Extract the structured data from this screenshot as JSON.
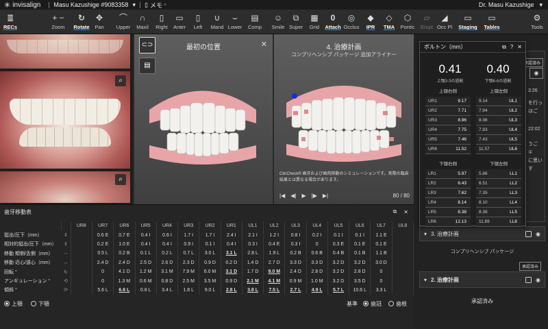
{
  "titlebar": {
    "brand": "invisalign",
    "patient": "Masu Kazushige #9083358",
    "memo": "メモ",
    "doctor": "Dr. Masu Kazushige"
  },
  "toolbar": [
    {
      "id": "recs",
      "label": "RECs",
      "icon": "≣",
      "active": true
    },
    {
      "id": "zoom",
      "label": "Zoom",
      "icon": "+ −"
    },
    {
      "id": "rotate",
      "label": "Rotate",
      "icon": "↻",
      "active": true
    },
    {
      "id": "pan",
      "label": "Pan",
      "icon": "✥"
    },
    {
      "id": "upper",
      "label": "Upper",
      "icon": "⌒"
    },
    {
      "id": "maxil",
      "label": "Maxil",
      "icon": "∩"
    },
    {
      "id": "right",
      "label": "Right",
      "icon": "▯"
    },
    {
      "id": "anter",
      "label": "Anter",
      "icon": "▭"
    },
    {
      "id": "left",
      "label": "Left",
      "icon": "▯"
    },
    {
      "id": "mand",
      "label": "Mand",
      "icon": "∪"
    },
    {
      "id": "lower",
      "label": "Lower",
      "icon": "⌣"
    },
    {
      "id": "comp",
      "label": "Comp",
      "icon": "▤"
    },
    {
      "id": "smile",
      "label": "Smile",
      "icon": "☺"
    },
    {
      "id": "super",
      "label": "Super",
      "icon": "⧉"
    },
    {
      "id": "grid",
      "label": "Grid",
      "icon": "▦"
    },
    {
      "id": "attach",
      "label": "Attach",
      "icon": "0",
      "active": true
    },
    {
      "id": "occlus",
      "label": "Occlus",
      "icon": "◎"
    },
    {
      "id": "ipr",
      "label": "IPR",
      "icon": "◆",
      "active": true
    },
    {
      "id": "tma",
      "label": "TMA",
      "icon": "◇",
      "active": true
    },
    {
      "id": "pontic",
      "label": "Pontic",
      "icon": "⬡"
    },
    {
      "id": "erupt",
      "label": "Erupt",
      "icon": "▱",
      "disabled": true
    },
    {
      "id": "occ_pl",
      "label": "Occ Pl",
      "icon": "◢"
    },
    {
      "id": "staging",
      "label": "Staging",
      "icon": "▭",
      "active": true
    },
    {
      "id": "tables",
      "label": "Tables",
      "icon": "▭",
      "active": true
    },
    {
      "id": "tools",
      "label": "Tools",
      "icon": "⚙"
    }
  ],
  "viewer_left": {
    "title": "最初の位置"
  },
  "viewer_right": {
    "title": "4. 治療計画",
    "subtitle": "コンプリヘンシブ パッケージ 追加アライナー",
    "disclaimer": "ClinCheck® 歯牙および歯肉移動のシミュレーションです。実際の臨床結果とは異なる場合があります。",
    "stage": "80 / 80"
  },
  "bolton": {
    "title": "ボルトン（mm）",
    "anterior": "0.41",
    "anterior_label": "上顎3-3の過剰",
    "overall": "0.40",
    "overall_label": "下顎6-6の過剰",
    "upper_right_h": "上顎右側",
    "upper_left_h": "上顎左側",
    "lower_right_h": "下顎右側",
    "lower_left_h": "下顎左側",
    "upper_right": [
      [
        "UR1",
        "9.17"
      ],
      [
        "UR2",
        "7.71"
      ],
      [
        "UR3",
        "8.96"
      ],
      [
        "UR4",
        "7.75"
      ],
      [
        "UR5",
        "7.46"
      ],
      [
        "UR6",
        "11.52"
      ]
    ],
    "upper_left": [
      [
        "9.14",
        "UL1"
      ],
      [
        "7.94",
        "UL2"
      ],
      [
        "8.98",
        "UL3"
      ],
      [
        "7.93",
        "UL4"
      ],
      [
        "7.43",
        "UL5"
      ],
      [
        "11.57",
        "UL6"
      ]
    ],
    "lower_right": [
      [
        "LR1",
        "5.97"
      ],
      [
        "LR2",
        "6.43"
      ],
      [
        "LR3",
        "7.62"
      ],
      [
        "LR4",
        "8.14"
      ],
      [
        "LR5",
        "8.38"
      ],
      [
        "LR6",
        "12.13"
      ]
    ],
    "lower_left": [
      [
        "5.86",
        "LL1"
      ],
      [
        "6.51",
        "LL2"
      ],
      [
        "7.35",
        "LL3"
      ],
      [
        "8.10",
        "LL4"
      ],
      [
        "8.38",
        "LL5"
      ],
      [
        "11.89",
        "LL6"
      ]
    ]
  },
  "right_panel": {
    "approved_tag": "承認済み",
    "peek1": "3:26",
    "peek2": "を行っ",
    "peek3": "はご",
    "peek4": "22:02",
    "peek5": "うご",
    "peek6": "①",
    "peek7": "に思い",
    "peek8": "す",
    "plan3": "3. 治療計画",
    "package": "コンプリヘンシブ パッケージ",
    "approved_tag2": "承認済み",
    "plan2": "2. 治療計画",
    "approved": "承認済み"
  },
  "movement": {
    "title": "歯牙移動表",
    "columns": [
      "UR8",
      "UR7",
      "UR6",
      "UR5",
      "UR4",
      "UR3",
      "UR2",
      "UR1",
      "UL1",
      "UL2",
      "UL3",
      "UL4",
      "UL5",
      "UL6",
      "UL7",
      "UL8"
    ],
    "rows": [
      {
        "label": "挺出/圧下（mm）",
        "icon": "⇕",
        "values": [
          "",
          "0.6 E",
          "0.7 E",
          "0.4 I",
          "0.6 I",
          "1.7 I",
          "1.7 I",
          "2.4 I",
          "2.1 I",
          "1.2 I",
          "0.8 I",
          "0.2 I",
          "0.1 I",
          "0.1 I",
          "1.1 E",
          ""
        ]
      },
      {
        "label": "相対的挺出/圧下（mm）",
        "icon": "⇕",
        "values": [
          "",
          "0.2 E",
          "1.0 E",
          "0.4 I",
          "0.4 I",
          "0.9 I",
          "0.1 I",
          "0.4 I",
          "0.3 I",
          "0.4 E",
          "0.3 I",
          "0",
          "0.3 E",
          "0.1 E",
          "0.1 E",
          ""
        ]
      },
      {
        "label": "移動 頬側/舌側（mm）",
        "icon": "↔",
        "values": [
          "",
          "0.5 L",
          "0.2 B",
          "0.1 L",
          "0.2 L",
          "0.7 L",
          "3.0 L",
          "3.1 L",
          "2.8 L",
          "1.9 L",
          "0.2 B",
          "0.6 B",
          "0.4 B",
          "0.1 B",
          "1.1 B",
          ""
        ]
      },
      {
        "label": "移動 近心/遠心（mm）",
        "icon": "↔",
        "values": [
          "",
          "2.4 D",
          "2.4 D",
          "2.5 D",
          "2.6 D",
          "2.3 D",
          "0.9 D",
          "0.2 D",
          "1.4 D",
          "2.7 D",
          "3.3 D",
          "3.3 D",
          "3.2 D",
          "3.2 D",
          "3.0 D",
          ""
        ]
      },
      {
        "label": "回転 °",
        "icon": "↻",
        "values": [
          "",
          "0",
          "4.1 D",
          "1.2 M",
          "3.1 M",
          "7.9 M",
          "6.0 M",
          "3.1 D",
          "1.7 D",
          "9.0 M",
          "2.4 D",
          "2.8 D",
          "3.2 D",
          "2.8 D",
          "0",
          ""
        ]
      },
      {
        "label": "アンギュレーション °",
        "icon": "⟲",
        "values": [
          "",
          "0",
          "1.3 M",
          "0.6 M",
          "0.8 D",
          "2.5 M",
          "3.5 M",
          "0.9 D",
          "2.1 M",
          "4.1 M",
          "0.9 M",
          "1.0 M",
          "3.2 D",
          "3.5 D",
          "0",
          ""
        ]
      },
      {
        "label": "傾斜 °",
        "icon": "⟳",
        "values": [
          "",
          "5.6 L",
          "6.6 L",
          "0.8 L",
          "3.4 L",
          "1.8 L",
          "9.0 L",
          "2.8 L",
          "3.8 L",
          "7.5 L",
          "2.7 L",
          "4.9 L",
          "5.7 L",
          "10.6 L",
          "3.3 L",
          ""
        ]
      }
    ],
    "underlined": [
      [
        2,
        7
      ],
      [
        4,
        7
      ],
      [
        4,
        9
      ],
      [
        5,
        8
      ],
      [
        5,
        9
      ],
      [
        6,
        2
      ],
      [
        6,
        7
      ],
      [
        6,
        8
      ],
      [
        6,
        9
      ],
      [
        6,
        10
      ],
      [
        6,
        11
      ],
      [
        6,
        12
      ]
    ]
  },
  "footer": {
    "upper": "上顎",
    "lower": "下顎",
    "basis": "基準",
    "crown": "歯冠",
    "root": "歯根"
  }
}
